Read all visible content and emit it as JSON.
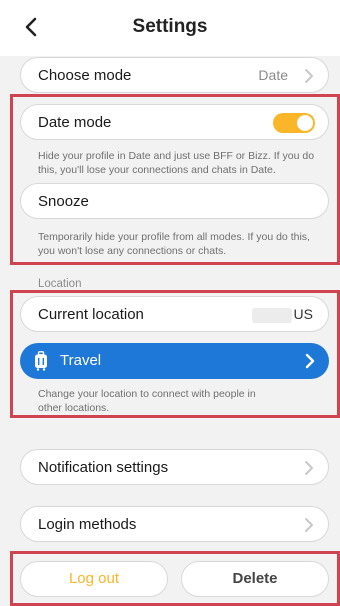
{
  "header": {
    "title": "Settings",
    "back_icon": "chevron-left-icon"
  },
  "choose_mode": {
    "label": "Choose mode",
    "value": "Date"
  },
  "date_mode": {
    "label": "Date mode",
    "enabled": true,
    "help": "Hide your profile in Date and just use BFF or Bizz. If you do this, you'll lose your connections and chats in Date."
  },
  "snooze": {
    "label": "Snooze",
    "help": "Temporarily hide your profile from all modes. If you do this, you won't lose any connections or chats."
  },
  "location": {
    "section_label": "Location",
    "current_label": "Current location",
    "current_value": "US",
    "travel_label": "Travel",
    "travel_help": "Change your location to connect with people in other locations."
  },
  "notification_settings": {
    "label": "Notification settings"
  },
  "login_methods": {
    "label": "Login methods"
  },
  "footer": {
    "logout_label": "Log out",
    "delete_label": "Delete"
  },
  "colors": {
    "accent": "#fbb528",
    "travel_blue": "#1e78d7",
    "highlight_red": "#cf4450",
    "background": "#f2f2f2"
  }
}
